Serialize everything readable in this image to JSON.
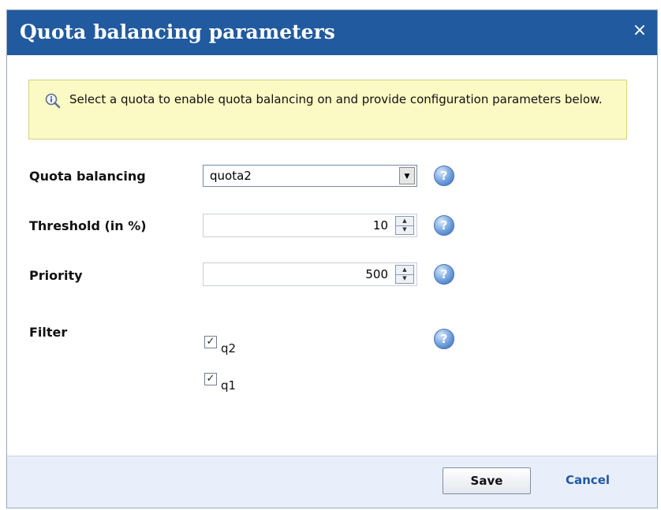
{
  "dialog": {
    "title": "Quota balancing parameters",
    "close_glyph": "×"
  },
  "info": {
    "icon": "info-magnifier-icon",
    "text": "Select a quota to enable quota balancing on and provide configuration parameters below."
  },
  "fields": {
    "quota_balancing": {
      "label": "Quota balancing",
      "value": "quota2"
    },
    "threshold": {
      "label": "Threshold (in %)",
      "value": "10"
    },
    "priority": {
      "label": "Priority",
      "value": "500"
    },
    "filter": {
      "label": "Filter",
      "options": [
        {
          "label": "q2",
          "checked": true
        },
        {
          "label": "q1",
          "checked": true
        }
      ]
    }
  },
  "help": {
    "icon": "help-icon",
    "glyph": "?"
  },
  "footer": {
    "save_label": "Save",
    "cancel_label": "Cancel"
  },
  "colors": {
    "titlebar": "#215a9e",
    "info_background": "#fbf9c4",
    "footer_background": "#e9effa",
    "link": "#1f5aa6"
  }
}
